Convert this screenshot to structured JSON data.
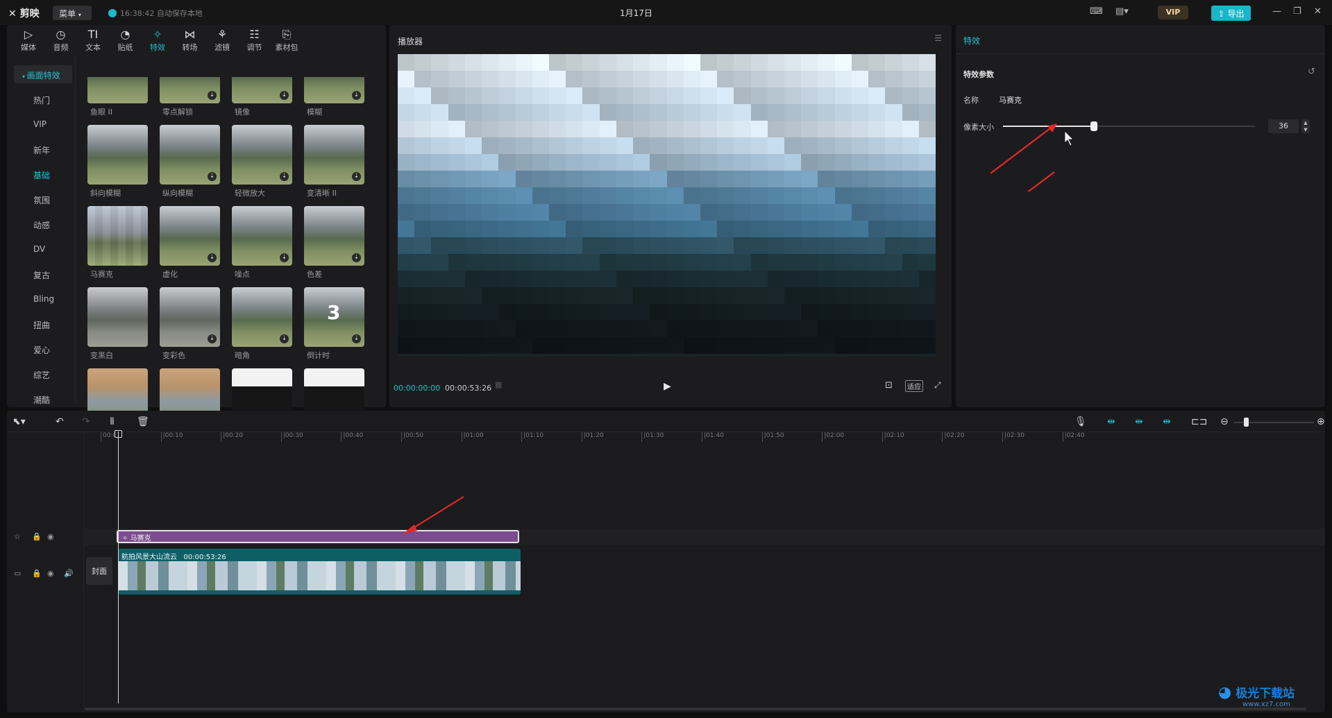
{
  "app": {
    "name": "剪映",
    "menu": "菜单",
    "save_status": "16:38:42 自动保存本地",
    "date": "1月17日",
    "vip": "VIP",
    "export": "导出"
  },
  "tabs": [
    {
      "label": "媒体",
      "icon": "media-icon"
    },
    {
      "label": "音频",
      "icon": "audio-icon"
    },
    {
      "label": "文本",
      "icon": "text-icon"
    },
    {
      "label": "贴纸",
      "icon": "sticker-icon"
    },
    {
      "label": "特效",
      "icon": "effects-icon"
    },
    {
      "label": "转场",
      "icon": "transition-icon"
    },
    {
      "label": "滤镜",
      "icon": "filter-icon"
    },
    {
      "label": "调节",
      "icon": "adjust-icon"
    },
    {
      "label": "素材包",
      "icon": "package-icon"
    }
  ],
  "active_tab": "特效",
  "categories": [
    "画面特效",
    "热门",
    "VIP",
    "新年",
    "基础",
    "氛围",
    "动感",
    "DV",
    "复古",
    "Bling",
    "扭曲",
    "爱心",
    "综艺",
    "潮酷"
  ],
  "effects": [
    {
      "label": "鱼眼 II"
    },
    {
      "label": "零点解锁"
    },
    {
      "label": "镜像"
    },
    {
      "label": "模糊"
    },
    {
      "label": "斜向模糊"
    },
    {
      "label": "纵向模糊"
    },
    {
      "label": "轻微放大"
    },
    {
      "label": "变清晰 II"
    },
    {
      "label": "马赛克"
    },
    {
      "label": "虚化"
    },
    {
      "label": "噪点"
    },
    {
      "label": "色差"
    },
    {
      "label": "变黑白"
    },
    {
      "label": "变彩色"
    },
    {
      "label": "暗角"
    },
    {
      "label": "倒计时",
      "overlay": "3"
    },
    {
      "label": ""
    },
    {
      "label": ""
    },
    {
      "label": ""
    },
    {
      "label": ""
    }
  ],
  "player": {
    "title": "播放器",
    "current_time": "00:00:00:00",
    "duration": "00:00:53:26",
    "fit_label": "适应"
  },
  "props": {
    "tab": "特效",
    "section": "特效参数",
    "name_label": "名称",
    "name_value": "马赛克",
    "param_label": "像素大小",
    "param_value": "36",
    "param_fraction": 0.36
  },
  "timeline": {
    "ticks": [
      "00:00",
      "|00:10",
      "|00:20",
      "|00:30",
      "|00:40",
      "|00:50",
      "|01:00",
      "|01:10",
      "|01:20",
      "|01:30",
      "|01:40",
      "|01:50",
      "|02:00",
      "|02:10",
      "|02:20",
      "|02:30",
      "|02:40"
    ],
    "fx_clip": "马赛克",
    "video_clip": "航拍风景大山流云",
    "video_duration": "00:00:53:26",
    "cover": "封面"
  },
  "watermark": {
    "title": "极光下载站",
    "url": "www.xz7.com"
  },
  "colors": {
    "accent": "#22c0d0",
    "fx_clip": "#7b4c8e",
    "video_clip": "#0f5e66",
    "annotation_arrow": "#e02a2a"
  }
}
